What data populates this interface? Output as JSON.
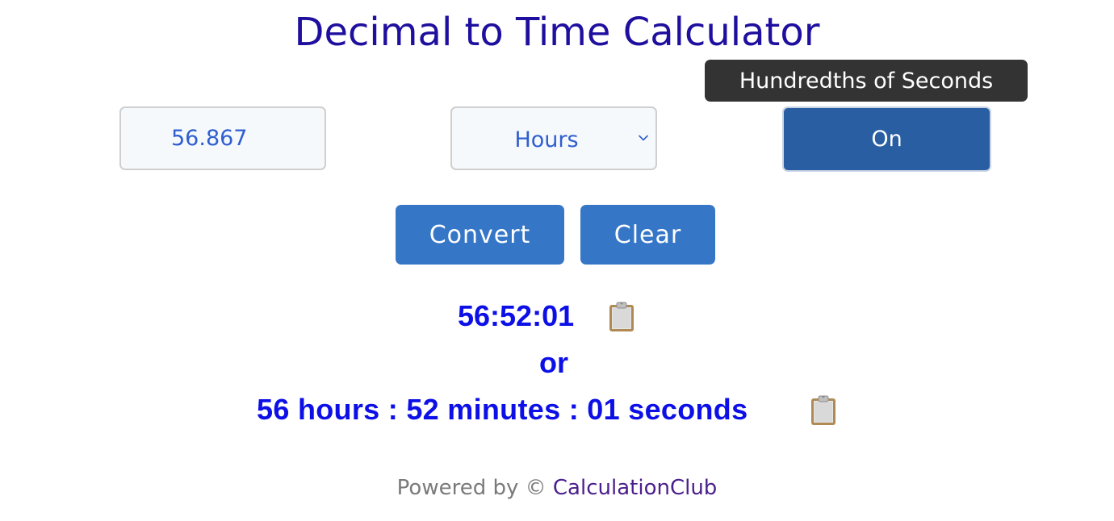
{
  "header": {
    "title": "Decimal to Time Calculator"
  },
  "inputs": {
    "decimal_value": "56.867",
    "unit_selected": "Hours",
    "hundredths_toggle_label": "On",
    "hundredths_tooltip": "Hundredths of Seconds"
  },
  "actions": {
    "convert_label": "Convert",
    "clear_label": "Clear"
  },
  "results": {
    "hms": "56:52:01",
    "or_text": "or",
    "words": "56 hours : 52 minutes : 01 seconds",
    "copy_icon": "clipboard-icon"
  },
  "footer": {
    "powered_by": "Powered by ©",
    "brand": "CalculationClub"
  },
  "colors": {
    "title": "#1f0f9e",
    "primary_button": "#3576c7",
    "toggle_on": "#295fa2",
    "result_text": "#0c10e6",
    "tooltip_bg": "#333333",
    "brand_link": "#4b1f8c"
  }
}
